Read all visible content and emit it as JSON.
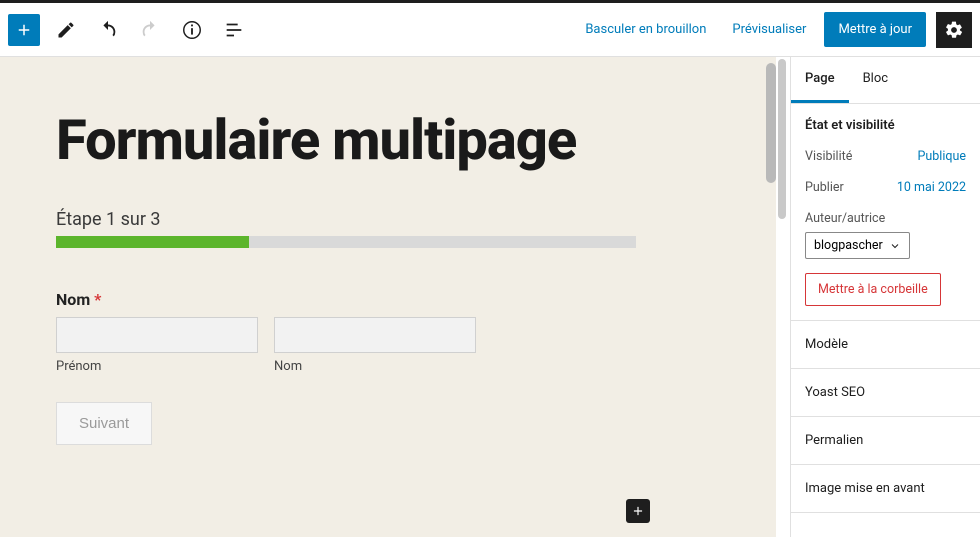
{
  "toolbar": {
    "switch_draft": "Basculer en brouillon",
    "preview": "Prévisualiser",
    "update": "Mettre à jour"
  },
  "page": {
    "title": "Formulaire multipage"
  },
  "form": {
    "step_label": "Étape 1 sur 3",
    "progress_percent": 33.3,
    "name_label": "Nom",
    "required_mark": "*",
    "firstname_label": "Prénom",
    "lastname_label": "Nom",
    "next_label": "Suivant"
  },
  "sidebar": {
    "tabs": {
      "page": "Page",
      "block": "Bloc"
    },
    "status_title": "État et visibilité",
    "visibility_label": "Visibilité",
    "visibility_value": "Publique",
    "publish_label": "Publier",
    "publish_value": "10 mai 2022",
    "author_label": "Auteur/autrice",
    "author_value": "blogpascher",
    "trash_label": "Mettre à la corbeille",
    "panels": {
      "model": "Modèle",
      "yoast": "Yoast SEO",
      "permalink": "Permalien",
      "featured_image": "Image mise en avant"
    }
  }
}
